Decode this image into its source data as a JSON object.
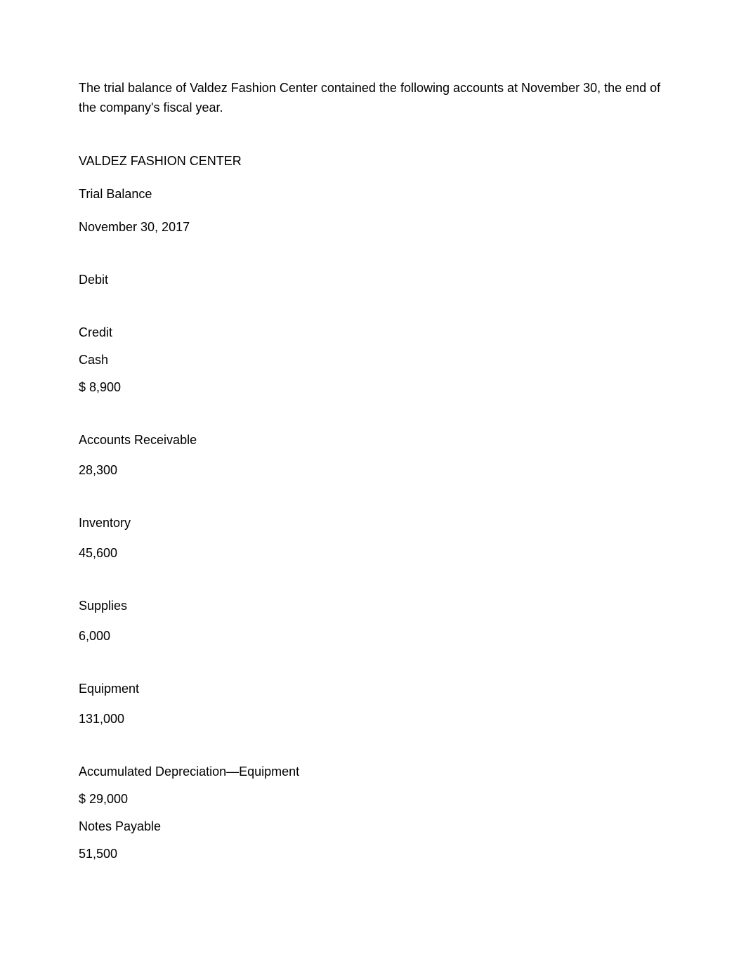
{
  "intro": "The trial balance of Valdez Fashion Center contained the following accounts at November 30, the end of the company's fiscal year.",
  "header": {
    "company": "VALDEZ FASHION CENTER",
    "report_title": "Trial Balance",
    "date": "November 30, 2017"
  },
  "columns": {
    "debit_label": "Debit",
    "credit_label": "Credit"
  },
  "accounts": {
    "cash": {
      "label": "Cash",
      "value": "$ 8,900"
    },
    "accounts_receivable": {
      "label": "Accounts Receivable",
      "value": "28,300"
    },
    "inventory": {
      "label": "Inventory",
      "value": "45,600"
    },
    "supplies": {
      "label": "Supplies",
      "value": "6,000"
    },
    "equipment": {
      "label": "Equipment",
      "value": "131,000"
    },
    "accum_depreciation": {
      "label": "Accumulated Depreciation—Equipment",
      "value": "$ 29,000"
    },
    "notes_payable": {
      "label": "Notes Payable",
      "value": "51,500"
    }
  }
}
